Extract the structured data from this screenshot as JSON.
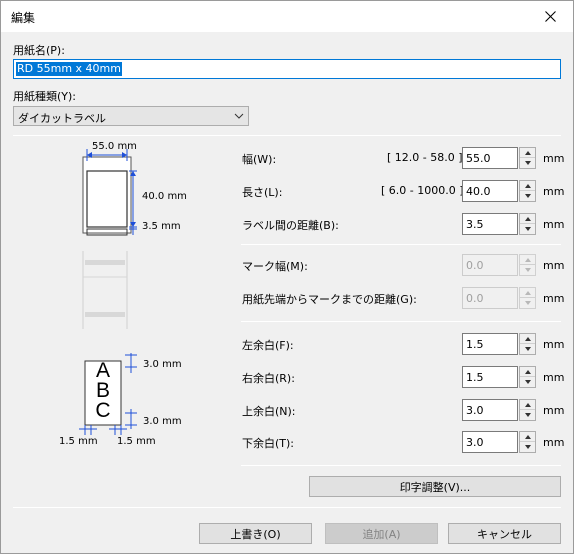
{
  "window": {
    "title": "編集"
  },
  "paper_name": {
    "label": "用紙名(P):",
    "value": "RD 55mm x 40mm"
  },
  "paper_type": {
    "label": "用紙種類(Y):",
    "selected": "ダイカットラベル"
  },
  "diagram": {
    "width_label": "55.0 mm",
    "height_label": "40.0 mm",
    "gap_label": "3.5 mm",
    "margin_top_label": "3.0 mm",
    "margin_bottom_label": "3.0 mm",
    "margin_left_label": "1.5 mm",
    "margin_right_label": "1.5 mm",
    "sample_letters": [
      "A",
      "B",
      "C"
    ]
  },
  "fields": {
    "width": {
      "label": "幅(W):",
      "range": "[ 12.0 - 58.0 ]",
      "value": "55.0",
      "unit": "mm"
    },
    "length": {
      "label": "長さ(L):",
      "range": "[ 6.0 - 1000.0 ]",
      "value": "40.0",
      "unit": "mm"
    },
    "gap": {
      "label": "ラベル間の距離(B):",
      "value": "3.5",
      "unit": "mm"
    },
    "mark_width": {
      "label": "マーク幅(M):",
      "value": "0.0",
      "unit": "mm"
    },
    "mark_distance": {
      "label": "用紙先端からマークまでの距離(G):",
      "value": "0.0",
      "unit": "mm"
    },
    "left_margin": {
      "label": "左余白(F):",
      "value": "1.5",
      "unit": "mm"
    },
    "right_margin": {
      "label": "右余白(R):",
      "value": "1.5",
      "unit": "mm"
    },
    "top_margin": {
      "label": "上余白(N):",
      "value": "3.0",
      "unit": "mm"
    },
    "bottom_margin": {
      "label": "下余白(T):",
      "value": "3.0",
      "unit": "mm"
    }
  },
  "buttons": {
    "print_adjust": "印字調整(V)...",
    "overwrite": "上書き(O)",
    "add": "追加(A)",
    "cancel": "キャンセル"
  },
  "colors": {
    "accent": "#0078d7",
    "dim_line": "#1e4fd8"
  }
}
